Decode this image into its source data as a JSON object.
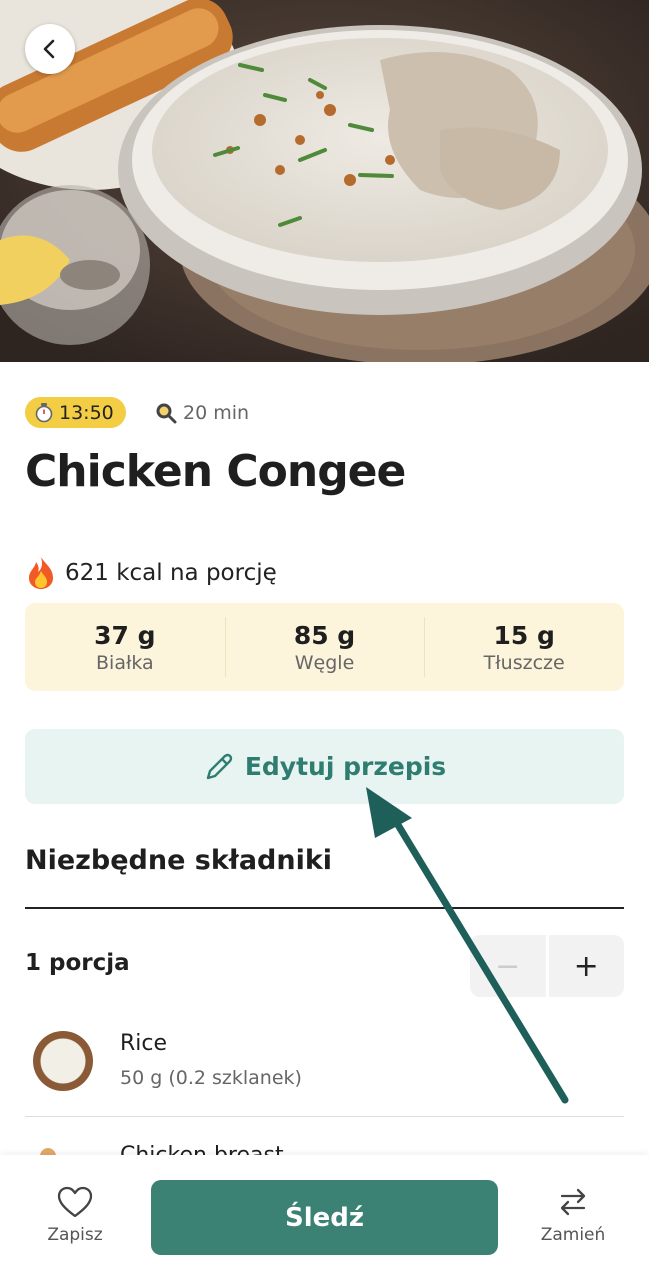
{
  "hero": {
    "image_alt": ""
  },
  "meta": {
    "time": "13:50",
    "cook_time": "20 min"
  },
  "recipe": {
    "title": "Chicken Congee",
    "kcal": "621 kcal na porcję"
  },
  "macros": [
    {
      "value": "37 g",
      "label": "Białka"
    },
    {
      "value": "85 g",
      "label": "Węgle"
    },
    {
      "value": "15 g",
      "label": "Tłuszcze"
    }
  ],
  "edit_button": {
    "label": "Edytuj przepis"
  },
  "ingredients_section": {
    "title": "Niezbędne składniki",
    "portion_label": "1 porcja",
    "minus": "−",
    "plus": "+",
    "items": [
      {
        "name": "Rice",
        "quantity": "50 g (0.2 szklanek)"
      },
      {
        "name": "Chicken breast",
        "quantity": ""
      }
    ]
  },
  "bottom_bar": {
    "save_label": "Zapisz",
    "track_label": "Śledź",
    "swap_label": "Zamień"
  },
  "colors": {
    "accent": "#3b8174",
    "accent_text": "#2f7d71",
    "time_pill": "#f3cd44",
    "macros_bg": "#fdf4dc",
    "edit_bg": "#e8f4f2",
    "arrow": "#1f5f5a"
  },
  "icons": [
    "back-chevron-icon",
    "stopwatch-icon",
    "pan-icon",
    "fire-icon",
    "pencil-icon",
    "heart-icon",
    "swap-arrows-icon"
  ]
}
